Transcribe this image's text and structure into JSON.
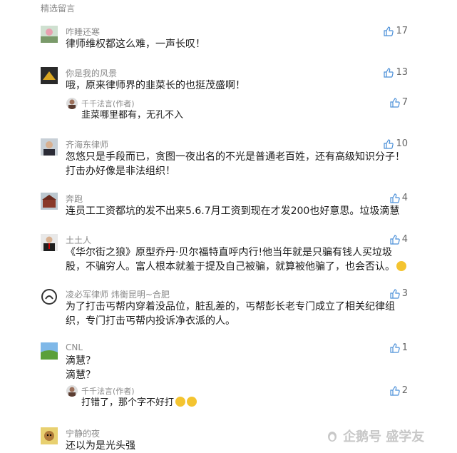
{
  "section_title": "精选留言",
  "comments": [
    {
      "name": "咋睡还寒",
      "text": "律师维权都这么难，一声长叹！",
      "likes": "17",
      "avatar": "landscape"
    },
    {
      "name": "你是我的风景",
      "text": "哦，原来律师界的韭菜长的也挺茂盛啊！",
      "likes": "13",
      "avatar": "yellow",
      "reply": {
        "name": "千千法言(作者)",
        "text": "韭菜哪里都有，无孔不入",
        "likes": "7"
      }
    },
    {
      "name": "齐海东律师",
      "text": "忽悠只是手段而已，贪图一夜出名的不光是普通老百姓，还有高级知识分子！打击办好像是非法组织！",
      "likes": "10",
      "avatar": "portrait"
    },
    {
      "name": "奔跑",
      "text": "连员工工资都坑的发不出来5.6.7月工资到现在才发200也好意思。垃圾滴慧",
      "likes": "4",
      "avatar": "building"
    },
    {
      "name": "土土人",
      "text": "《华尔街之狼》原型乔丹·贝尔福特直呼内行!他当年就是只骗有钱人买垃圾股，不骗穷人。富人根本就羞于提及自己被骗，就算被他骗了，也会否认。",
      "likes": "4",
      "avatar": "suit"
    },
    {
      "name": "凌必军律师  炜衡昆明~合肥",
      "text": "为了打击丐帮内穿着没品位，脏乱差的，丐帮彭长老专门成立了相关纪律组织，专门打击丐帮内投诉净衣派的人。",
      "likes": "3",
      "avatar": "sketch"
    },
    {
      "name": "CNL",
      "text1": "滴慧？",
      "text2": "滴慧？",
      "likes": "1",
      "avatar": "meadow",
      "reply": {
        "name": "千千法言(作者)",
        "text": "打错了，那个字不好打",
        "likes": "2"
      }
    },
    {
      "name": "宁静的夜",
      "text": "还以为是光头强",
      "avatar": "cartoon"
    }
  ],
  "watermark": "企鹅号 盛学友"
}
